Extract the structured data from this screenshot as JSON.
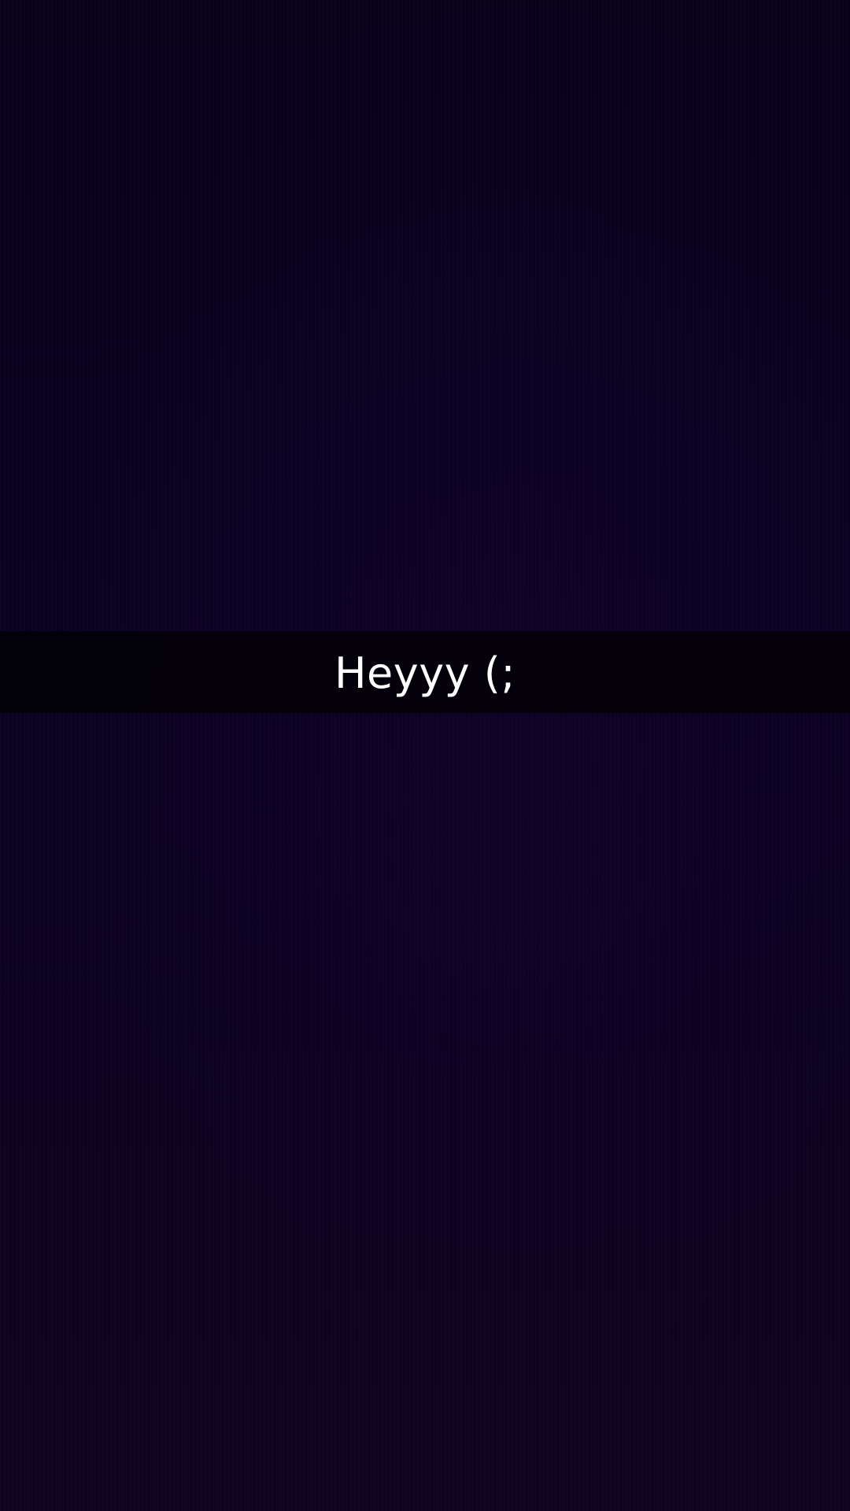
{
  "snap": {
    "caption": "Heyyy (;",
    "background_color": "#0b0119",
    "caption_text_color": "#ffffff"
  }
}
